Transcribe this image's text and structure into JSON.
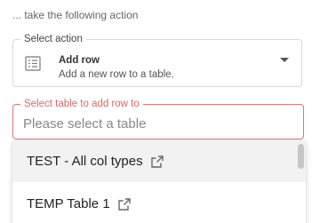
{
  "intro_text": "... take the following action",
  "action_select": {
    "label": "Select action",
    "icon": "list-table-icon",
    "title": "Add row",
    "description": "Add a new row to a table."
  },
  "table_select": {
    "label": "Select table to add row to",
    "placeholder": "Please select a table",
    "value": "",
    "accent_color": "#e57373"
  },
  "table_options": [
    {
      "label": "TEST - All col types",
      "icon": "external-link-icon"
    },
    {
      "label": "TEMP Table 1",
      "icon": "external-link-icon"
    }
  ]
}
